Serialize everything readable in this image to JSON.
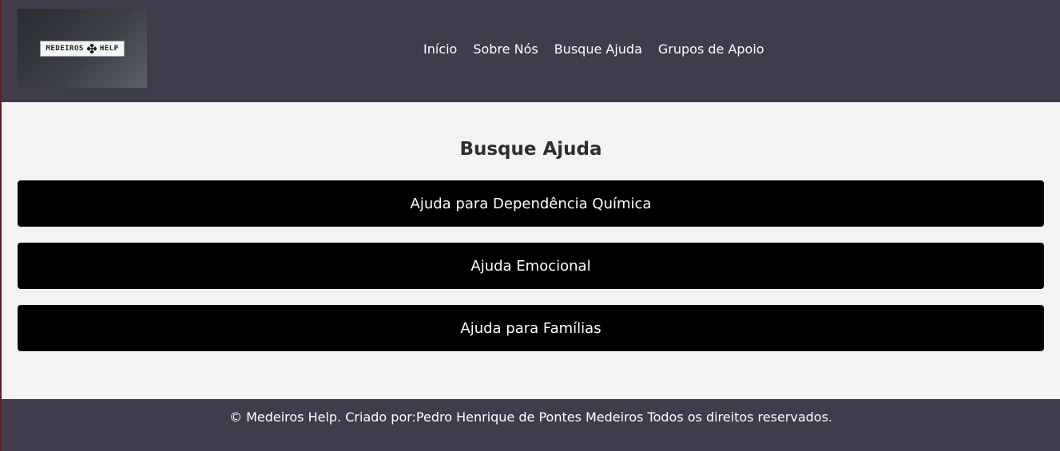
{
  "header": {
    "logo_text_left": "MEDEIROS",
    "logo_text_right": "HELP",
    "nav": [
      {
        "label": "Início"
      },
      {
        "label": "Sobre Nós"
      },
      {
        "label": "Busque Ajuda"
      },
      {
        "label": "Grupos de Apoio"
      }
    ]
  },
  "main": {
    "title": "Busque Ajuda",
    "buttons": [
      {
        "label": "Ajuda para Dependência Química"
      },
      {
        "label": "Ajuda Emocional"
      },
      {
        "label": "Ajuda para Famílias"
      }
    ]
  },
  "footer": {
    "text": "© Medeiros Help. Criado por:Pedro Henrique de Pontes Medeiros Todos os direitos reservados."
  },
  "colors": {
    "header_bg": "#3f3c4b",
    "page_bg": "#f3f3f3",
    "button_bg": "#000000",
    "text_light": "#ffffff"
  },
  "icons": {
    "logo_mark": "diamond-cross-icon"
  }
}
